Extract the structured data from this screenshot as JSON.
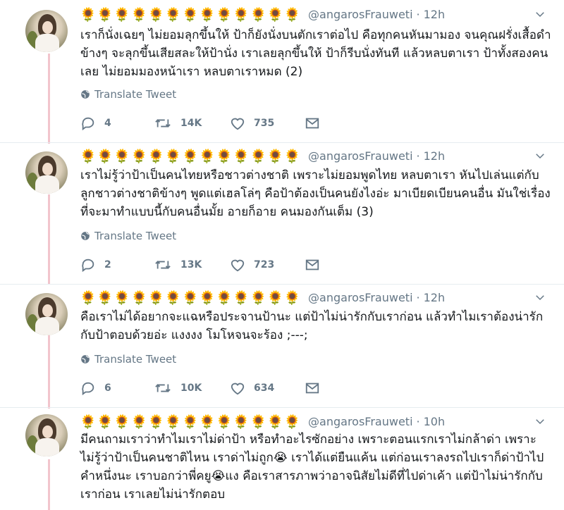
{
  "tweets": [
    {
      "name": "🌻🌻🌻🌻🌻🌻🌻🌻🌻🌻🌻🌻🌻",
      "handle": "@angarosFrauweti",
      "dot": "·",
      "time": "12h",
      "text": "เราก็นั่งเฉยๆ ไม่ยอมลุกขึ้นให้ ป้าก็ยังนั่งบนตักเราต่อไป คือทุกคนหันมามอง จนคุณฝรั่งเสื้อดำข้างๆ จะลุกขึ้นเสียสละให้ป้านั่ง เราเลยลุกขึ้นให้ ป้าก็รีบนั่งทันที แล้วหลบตาเรา ป้าทั้งสองคนเลย ไม่ยอมมองหน้าเรา หลบตาเราหมด (2)",
      "translate": "Translate Tweet",
      "replies": "4",
      "retweets": "14K",
      "likes": "735"
    },
    {
      "name": "🌻🌻🌻🌻🌻🌻🌻🌻🌻🌻🌻🌻🌻",
      "handle": "@angarosFrauweti",
      "dot": "·",
      "time": "12h",
      "text": "เราไม่รู้ว่าป้าเป็นคนไทยหรือชาวต่างชาติ เพราะไม่ยอมพูดไทย หลบตาเรา หันไปเล่นแต่กับลูกชาวต่างชาติข้างๆ พูดแต่เฮลโล่ๆ คือป้าต้องเป็นคนยังไงอ่ะ มาเบียดเบียนคนอื่น มันใช่เรื่องที่จะมาทำแบบนี้กับคนอื่นมั้ย อายก็อาย คนมองกันเต็ม (3)",
      "translate": "Translate Tweet",
      "replies": "2",
      "retweets": "13K",
      "likes": "723"
    },
    {
      "name": "🌻🌻🌻🌻🌻🌻🌻🌻🌻🌻🌻🌻🌻",
      "handle": "@angarosFrauweti",
      "dot": "·",
      "time": "12h",
      "text": "คือเราไม่ได้อยากจะแฉหรือประจานป้านะ แต่ป้าไม่น่ารักกับเราก่อน แล้วทำไมเราต้องน่ารักกับป้าตอบด้วยอ่ะ แงงงง โมโหจนจะร้อง ;---;",
      "translate": "Translate Tweet",
      "replies": "6",
      "retweets": "10K",
      "likes": "634"
    },
    {
      "name": "🌻🌻🌻🌻🌻🌻🌻🌻🌻🌻🌻🌻🌻",
      "handle": "@angarosFrauweti",
      "dot": "·",
      "time": "10h",
      "text": "มีคนถามเราว่าทำไมเราไม่ด่าป้า หรือทำอะไรซักอย่าง เพราะตอนแรกเราไม่กล้าด่า เพราะไม่รู้ว่าป้าเป็นคนชาติไหน เราด่าไม่ถูก😭 เราได้แต่ยืนแค้น แต่ก่อนเราลงรถไปเราก็ด่าป้าไปคำหนึ่งนะ เราบอกว่าพี่คยู😭แง คือเราสารภาพว่าอาจนิสัยไม่ดีที่ไปด่าเค้า แต่ป้าไม่น่ารักกับเราก่อน เราเลยไม่น่ารักตอบ"
    }
  ]
}
